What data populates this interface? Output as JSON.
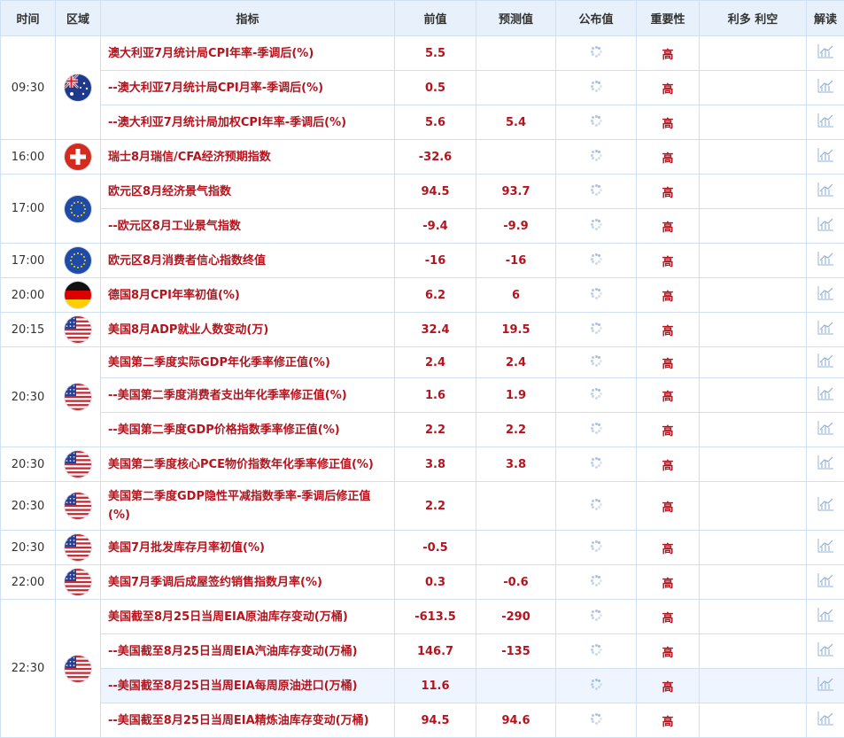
{
  "header": {
    "time": "时间",
    "region": "区域",
    "indicator": "指标",
    "previous": "前值",
    "forecast": "预测值",
    "published": "公布值",
    "importance": "重要性",
    "bull_bear": "利多 利空",
    "interpret": "解读"
  },
  "groups": [
    {
      "time": "09:30",
      "flag": "australia-flag",
      "rows": [
        {
          "indicator": "澳大利亚7月统计局CPI年率-季调后(%)",
          "previous": "5.5",
          "forecast": "",
          "importance": "高"
        },
        {
          "indicator": "--澳大利亚7月统计局CPI月率-季调后(%)",
          "previous": "0.5",
          "forecast": "",
          "importance": "高"
        },
        {
          "indicator": "--澳大利亚7月统计局加权CPI年率-季调后(%)",
          "previous": "5.6",
          "forecast": "5.4",
          "importance": "高"
        }
      ]
    },
    {
      "time": "16:00",
      "flag": "switzerland-flag",
      "rows": [
        {
          "indicator": "瑞士8月瑞信/CFA经济预期指数",
          "previous": "-32.6",
          "forecast": "",
          "importance": "高"
        }
      ]
    },
    {
      "time": "17:00",
      "flag": "eu-flag",
      "rows": [
        {
          "indicator": "欧元区8月经济景气指数",
          "previous": "94.5",
          "forecast": "93.7",
          "importance": "高"
        },
        {
          "indicator": "--欧元区8月工业景气指数",
          "previous": "-9.4",
          "forecast": "-9.9",
          "importance": "高"
        }
      ]
    },
    {
      "time": "17:00",
      "flag": "eu-flag",
      "rows": [
        {
          "indicator": "欧元区8月消费者信心指数终值",
          "previous": "-16",
          "forecast": "-16",
          "importance": "高"
        }
      ]
    },
    {
      "time": "20:00",
      "flag": "germany-flag",
      "rows": [
        {
          "indicator": "德国8月CPI年率初值(%)",
          "previous": "6.2",
          "forecast": "6",
          "importance": "高"
        }
      ]
    },
    {
      "time": "20:15",
      "flag": "usa-flag",
      "rows": [
        {
          "indicator": "美国8月ADP就业人数变动(万)",
          "previous": "32.4",
          "forecast": "19.5",
          "importance": "高"
        }
      ]
    },
    {
      "time": "20:30",
      "flag": "usa-flag",
      "rows": [
        {
          "indicator": "美国第二季度实际GDP年化季率修正值(%)",
          "previous": "2.4",
          "forecast": "2.4",
          "importance": "高"
        },
        {
          "indicator": "--美国第二季度消费者支出年化季率修正值(%)",
          "previous": "1.6",
          "forecast": "1.9",
          "importance": "高"
        },
        {
          "indicator": "--美国第二季度GDP价格指数季率修正值(%)",
          "previous": "2.2",
          "forecast": "2.2",
          "importance": "高"
        }
      ]
    },
    {
      "time": "20:30",
      "flag": "usa-flag",
      "rows": [
        {
          "indicator": "美国第二季度核心PCE物价指数年化季率修正值(%)",
          "previous": "3.8",
          "forecast": "3.8",
          "importance": "高"
        }
      ]
    },
    {
      "time": "20:30",
      "flag": "usa-flag",
      "rows": [
        {
          "indicator": "美国第二季度GDP隐性平减指数季率-季调后修正值(%)",
          "previous": "2.2",
          "forecast": "",
          "importance": "高"
        }
      ]
    },
    {
      "time": "20:30",
      "flag": "usa-flag",
      "rows": [
        {
          "indicator": "美国7月批发库存月率初值(%)",
          "previous": "-0.5",
          "forecast": "",
          "importance": "高"
        }
      ]
    },
    {
      "time": "22:00",
      "flag": "usa-flag",
      "rows": [
        {
          "indicator": "美国7月季调后成屋签约销售指数月率(%)",
          "previous": "0.3",
          "forecast": "-0.6",
          "importance": "高"
        }
      ]
    },
    {
      "time": "22:30",
      "flag": "usa-flag",
      "rows": [
        {
          "indicator": "美国截至8月25日当周EIA原油库存变动(万桶)",
          "previous": "-613.5",
          "forecast": "-290",
          "importance": "高"
        },
        {
          "indicator": "--美国截至8月25日当周EIA汽油库存变动(万桶)",
          "previous": "146.7",
          "forecast": "-135",
          "importance": "高"
        },
        {
          "indicator": "--美国截至8月25日当周EIA每周原油进口(万桶)",
          "previous": "11.6",
          "forecast": "",
          "importance": "高",
          "highlight": true
        },
        {
          "indicator": "--美国截至8月25日当周EIA精炼油库存变动(万桶)",
          "previous": "94.5",
          "forecast": "94.6",
          "importance": "高"
        }
      ]
    }
  ],
  "colors": {
    "accent_red": "#b4141e",
    "header_bg": "#e8f1fb",
    "border": "#cfe0f3",
    "highlight_row": "#eef5ff"
  }
}
